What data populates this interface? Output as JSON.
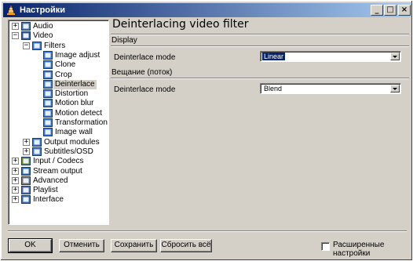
{
  "window": {
    "title": "Настройки"
  },
  "titlebar_buttons": {
    "minimize": "_",
    "maximize": "□",
    "close": "×"
  },
  "tree": {
    "items": [
      {
        "label": "Audio",
        "level": 0,
        "expander": "+",
        "icon": "speaker-icon"
      },
      {
        "label": "Video",
        "level": 0,
        "expander": "−",
        "icon": "video-icon"
      },
      {
        "label": "Filters",
        "level": 1,
        "expander": "−",
        "icon": "module-icon"
      },
      {
        "label": "Image adjust",
        "level": 2,
        "expander": "",
        "icon": "module-icon"
      },
      {
        "label": "Clone",
        "level": 2,
        "expander": "",
        "icon": "module-icon"
      },
      {
        "label": "Crop",
        "level": 2,
        "expander": "",
        "icon": "module-icon"
      },
      {
        "label": "Deinterlace",
        "level": 2,
        "expander": "",
        "icon": "module-icon",
        "selected": true
      },
      {
        "label": "Distortion",
        "level": 2,
        "expander": "",
        "icon": "module-icon"
      },
      {
        "label": "Motion blur",
        "level": 2,
        "expander": "",
        "icon": "module-icon"
      },
      {
        "label": "Motion detect",
        "level": 2,
        "expander": "",
        "icon": "module-icon"
      },
      {
        "label": "Transformation",
        "level": 2,
        "expander": "",
        "icon": "module-icon"
      },
      {
        "label": "Image wall",
        "level": 2,
        "expander": "",
        "icon": "module-icon"
      },
      {
        "label": "Output modules",
        "level": 1,
        "expander": "+",
        "icon": "module-icon"
      },
      {
        "label": "Subtitles/OSD",
        "level": 1,
        "expander": "+",
        "icon": "module-icon"
      },
      {
        "label": "Input / Codecs",
        "level": 0,
        "expander": "+",
        "icon": "codecs-icon"
      },
      {
        "label": "Stream output",
        "level": 0,
        "expander": "+",
        "icon": "globe-icon"
      },
      {
        "label": "Advanced",
        "level": 0,
        "expander": "+",
        "icon": "tools-icon"
      },
      {
        "label": "Playlist",
        "level": 0,
        "expander": "+",
        "icon": "playlist-icon"
      },
      {
        "label": "Interface",
        "level": 0,
        "expander": "+",
        "icon": "interface-icon"
      }
    ]
  },
  "panel": {
    "title": "Deinterlacing video filter",
    "sections": [
      {
        "header": "Display",
        "field_label": "Deinterlace mode",
        "value": "Linear"
      },
      {
        "header": "Вещание (поток)",
        "field_label": "Deinterlace mode",
        "value": "Blend"
      }
    ]
  },
  "buttons": {
    "ok": "OK",
    "cancel": "Отменить",
    "save": "Сохранить",
    "reset": "Сбросить всё"
  },
  "advanced_checkbox": {
    "label": "Расширенные настройки",
    "checked": false
  },
  "colors": {
    "titlebar_start": "#0a246a",
    "titlebar_end": "#a6caf0",
    "face": "#d4d0c8"
  }
}
